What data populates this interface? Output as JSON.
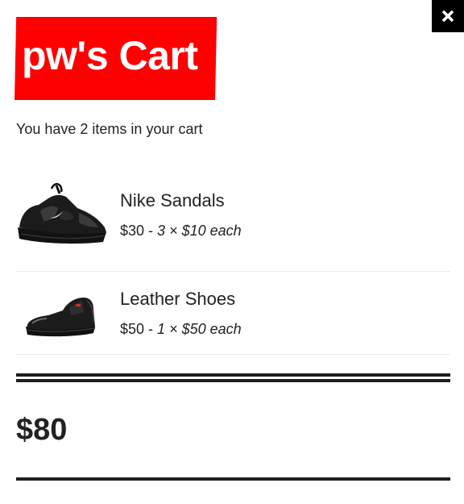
{
  "header": {
    "close_icon": "close-icon",
    "title": "pw's Cart",
    "title_bg_color": "#ff0000"
  },
  "cart": {
    "summary": "You have 2 items in your cart",
    "items": [
      {
        "name": "Nike Sandals",
        "subtotal": "$30",
        "separator": " - ",
        "quantity_text": "3 × $10 each",
        "image_icon": "sandal-image"
      },
      {
        "name": "Leather Shoes",
        "subtotal": "$50",
        "separator": " - ",
        "quantity_text": "1 × $50 each",
        "image_icon": "leather-shoe-image"
      }
    ],
    "total": "$80"
  }
}
